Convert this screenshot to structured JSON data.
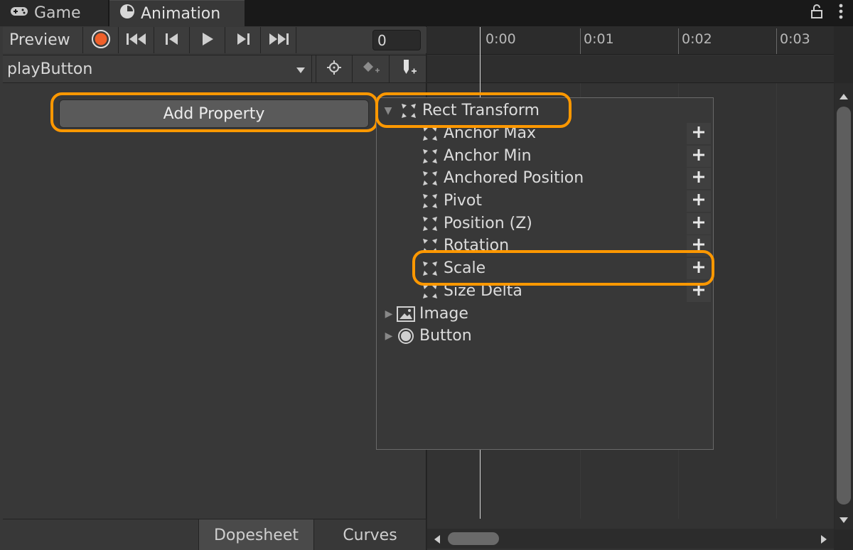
{
  "tabs": [
    {
      "label": "Game",
      "icon": "gamepad-icon"
    },
    {
      "label": "Animation",
      "icon": "clock-icon"
    }
  ],
  "toolbar": {
    "preview_label": "Preview",
    "frame_value": "0"
  },
  "clip": {
    "selected": "playButton"
  },
  "add_property_label": "Add Property",
  "timeline": {
    "ticks": [
      "0:00",
      "0:01",
      "0:02",
      "0:03"
    ]
  },
  "menu": {
    "rect_transform": {
      "label": "Rect Transform",
      "expanded": true,
      "children": [
        "Anchor Max",
        "Anchor Min",
        "Anchored Position",
        "Pivot",
        "Position (Z)",
        "Rotation",
        "Scale",
        "Size Delta"
      ]
    },
    "image_label": "Image",
    "button_label": "Button"
  },
  "bottom_tabs": {
    "dopesheet": "Dopesheet",
    "curves": "Curves"
  },
  "colors": {
    "highlight": "#ff9800",
    "record": "#f0602a"
  }
}
